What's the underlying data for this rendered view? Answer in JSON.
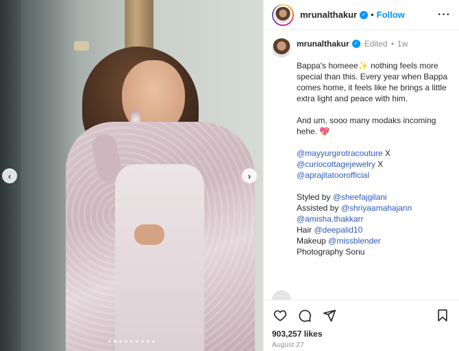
{
  "post": {
    "username": "mrunalthakur",
    "follow_label": "Follow",
    "header_separator": "•",
    "more_label": "···"
  },
  "caption": {
    "username": "mrunalthakur",
    "edited_label": "Edited",
    "meta_separator": "•",
    "time": "1w",
    "text_1": "Bappa's homeee✨ nothing feels more special than this. Every year when Bappa comes home, it feels like he brings a little extra light and peace with him.",
    "text_2_plain": "And um, sooo many modaks incoming hehe.",
    "text_2_emoji": "💖",
    "tag_1": "@mayyurgirotracouture",
    "tag_1_suffix": " X",
    "tag_2": "@curiocottagejewelry",
    "tag_2_suffix": " X",
    "tag_3": "@aprajitatoorofficial",
    "styled_prefix": "Styled by ",
    "styled_tag": "@sheefajgilani",
    "assisted_prefix": "Assisted by ",
    "assisted_tag": "@shriyaamahajann",
    "assisted_tag_2": "@amisha.thakkarr",
    "hair_prefix": "Hair ",
    "hair_tag": "@deepalid10",
    "makeup_prefix": "Makeup ",
    "makeup_tag": "@missblender",
    "photo_line": "Photography Sonu"
  },
  "carousel": {
    "prev_label": "‹",
    "next_label": "›",
    "slide_count": 9,
    "active_index": 1
  },
  "actions": {
    "icons": [
      "heart-icon",
      "comment-icon",
      "share-icon",
      "save-icon"
    ],
    "likes": "903,257 likes",
    "date": "August 27"
  }
}
